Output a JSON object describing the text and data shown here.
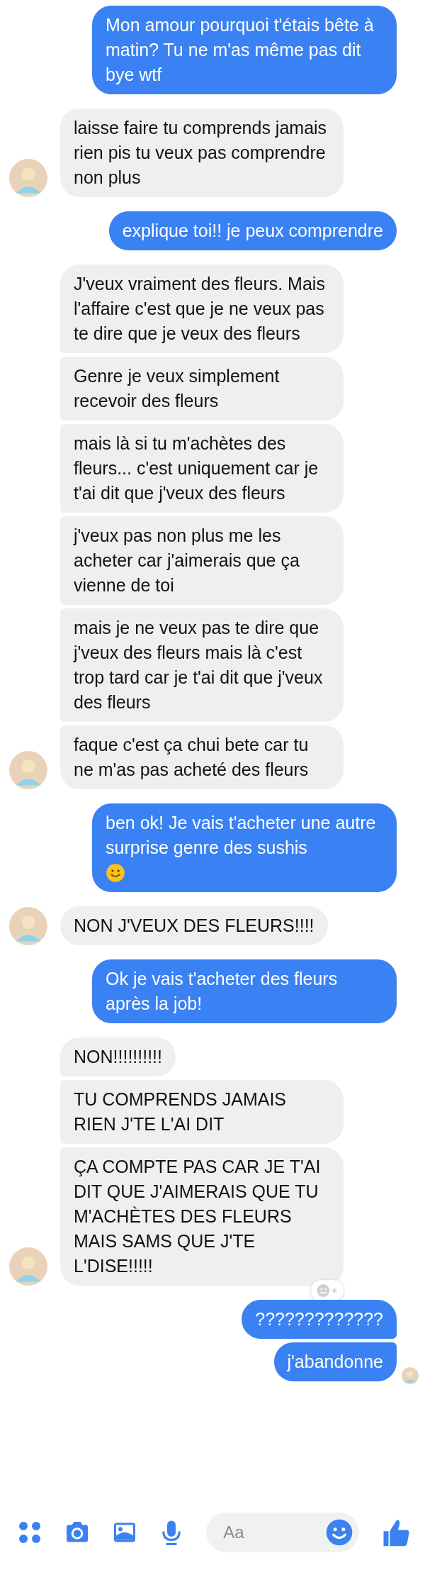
{
  "groups": [
    {
      "kind": "sent",
      "messages": [
        {
          "text": "Mon amour pourquoi t'étais bête à matin? Tu ne m'as même pas dit bye wtf"
        }
      ]
    },
    {
      "kind": "received",
      "messages": [
        {
          "text": "laisse faire tu comprends jamais rien pis tu veux pas comprendre non plus"
        }
      ]
    },
    {
      "kind": "sent",
      "messages": [
        {
          "text": "explique toi!! je peux comprendre"
        }
      ]
    },
    {
      "kind": "received",
      "messages": [
        {
          "text": "J'veux vraiment des fleurs. Mais l'affaire c'est que je ne veux pas te dire que je veux des fleurs"
        },
        {
          "text": "Genre je veux simplement recevoir des fleurs"
        },
        {
          "text": "mais là si tu m'achètes des fleurs... c'est uniquement car je t'ai dit que j'veux des fleurs"
        },
        {
          "text": "j'veux pas non plus me les acheter car j'aimerais que ça vienne de toi"
        },
        {
          "text": "mais je ne veux pas te dire que j'veux des fleurs mais là c'est trop tard car je t'ai dit que j'veux des fleurs"
        },
        {
          "text": "faque c'est ça chui bete car tu ne m'as pas acheté des fleurs"
        }
      ]
    },
    {
      "kind": "sent",
      "messages": [
        {
          "text": "ben ok! Je vais t'acheter une autre surprise genre des sushis",
          "has_emoji": true
        }
      ]
    },
    {
      "kind": "received",
      "messages": [
        {
          "text": "NON J'VEUX DES FLEURS!!!!"
        }
      ]
    },
    {
      "kind": "sent",
      "messages": [
        {
          "text": "Ok je vais t'acheter des fleurs après la job!"
        }
      ]
    },
    {
      "kind": "received",
      "messages": [
        {
          "text": "NON!!!!!!!!!!"
        },
        {
          "text": "TU COMPRENDS JAMAIS RIEN J'TE L'AI DIT"
        },
        {
          "text": "ÇA COMPTE PAS CAR JE T'AI DIT QUE J'AIMERAIS QUE TU M'ACHÈTES DES FLEURS MAIS SAMS QUE J'TE L'DISE!!!!!",
          "reaction_button": true
        }
      ]
    },
    {
      "kind": "sent",
      "seen": true,
      "messages": [
        {
          "text": "?????????????"
        },
        {
          "text": "j'abandonne"
        }
      ]
    }
  ],
  "composer": {
    "placeholder": "Aa"
  }
}
